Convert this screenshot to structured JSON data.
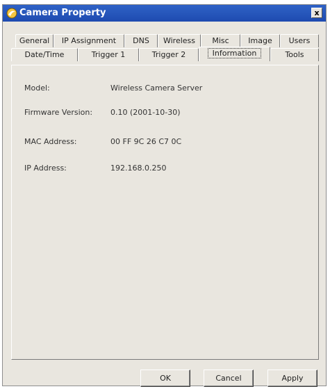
{
  "window": {
    "title": "Camera Property",
    "close_symbol": "x"
  },
  "tabs_row1": [
    "General",
    "IP Assignment",
    "DNS",
    "Wireless",
    "Misc",
    "Image",
    "Users"
  ],
  "tabs_row2": [
    "Date/Time",
    "Trigger 1",
    "Trigger 2",
    "Information",
    "Tools"
  ],
  "active_tab": "Information",
  "info": {
    "model_label": "Model:",
    "model_value": "Wireless Camera Server",
    "firmware_label": "Firmware Version:",
    "firmware_value": "0.10 (2001-10-30)",
    "mac_label": "MAC Address:",
    "mac_value": "00 FF 9C 26 C7 0C",
    "ip_label": "IP Address:",
    "ip_value": "192.168.0.250"
  },
  "buttons": {
    "ok": "OK",
    "cancel": "Cancel",
    "apply": "Apply"
  },
  "icons": {
    "app": "camera-property-icon"
  }
}
